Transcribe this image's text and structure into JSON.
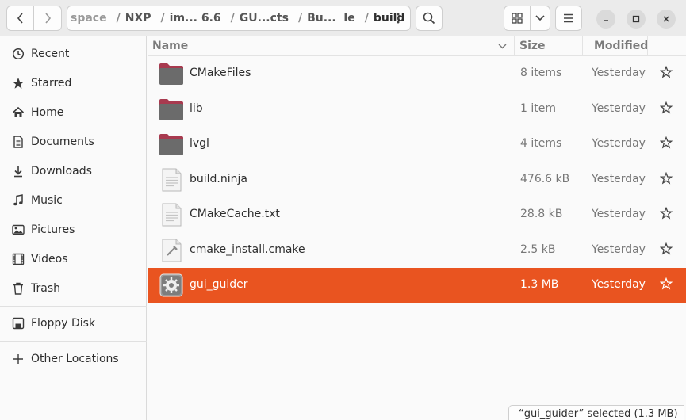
{
  "pathbar": {
    "crumbs": [
      "space",
      "NXP",
      "im... 6.6",
      "GU...cts",
      "Bu...  le",
      "build"
    ]
  },
  "header": {
    "icons": {
      "back": "chevron-left-icon",
      "forward": "chevron-right-icon",
      "path_menu": "vertical-dots-icon",
      "search": "search-icon",
      "view_grid": "grid-view-icon",
      "view_dropdown": "chevron-down-icon",
      "main_menu": "hamburger-icon",
      "minimize": "minimize-icon",
      "maximize": "maximize-icon",
      "close": "close-icon"
    }
  },
  "sidebar": {
    "items": [
      {
        "label": "Recent",
        "icon": "clock-icon"
      },
      {
        "label": "Starred",
        "icon": "star-icon"
      },
      {
        "label": "Home",
        "icon": "home-icon"
      },
      {
        "label": "Documents",
        "icon": "document-icon"
      },
      {
        "label": "Downloads",
        "icon": "download-icon"
      },
      {
        "label": "Music",
        "icon": "music-icon"
      },
      {
        "label": "Pictures",
        "icon": "picture-icon"
      },
      {
        "label": "Videos",
        "icon": "video-icon"
      },
      {
        "label": "Trash",
        "icon": "trash-icon"
      },
      {
        "label": "Floppy Disk",
        "icon": "floppy-icon"
      },
      {
        "label": "Other Locations",
        "icon": "plus-icon"
      }
    ]
  },
  "columns": {
    "name": "Name",
    "size": "Size",
    "modified": "Modified"
  },
  "files": [
    {
      "name": "CMakeFiles",
      "size": "8 items",
      "modified": "Yesterday",
      "type": "folder"
    },
    {
      "name": "lib",
      "size": "1 item",
      "modified": "Yesterday",
      "type": "folder"
    },
    {
      "name": "lvgl",
      "size": "4 items",
      "modified": "Yesterday",
      "type": "folder"
    },
    {
      "name": "build.ninja",
      "size": "476.6 kB",
      "modified": "Yesterday",
      "type": "text"
    },
    {
      "name": "CMakeCache.txt",
      "size": "28.8 kB",
      "modified": "Yesterday",
      "type": "text"
    },
    {
      "name": "cmake_install.cmake",
      "size": "2.5 kB",
      "modified": "Yesterday",
      "type": "script"
    },
    {
      "name": "gui_guider",
      "size": "1.3 MB",
      "modified": "Yesterday",
      "type": "executable",
      "selected": true
    }
  ],
  "status": {
    "text": "“gui_guider” selected  (1.3 MB)"
  },
  "colors": {
    "accent": "#e95420",
    "folder": "#6b6b6b",
    "folder_tab": "#a83a4f"
  }
}
